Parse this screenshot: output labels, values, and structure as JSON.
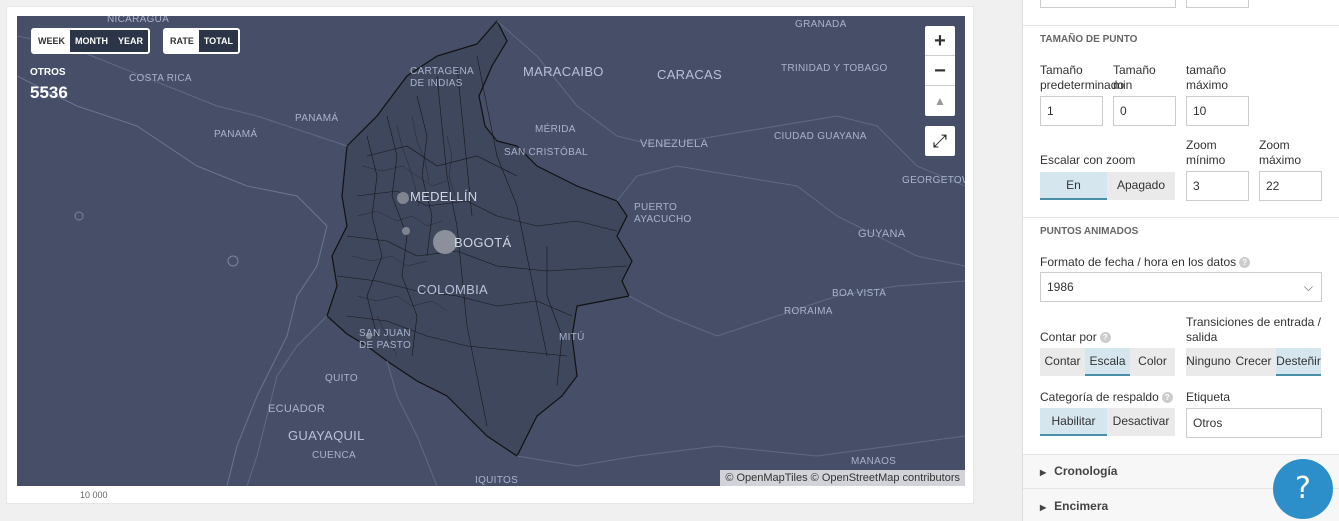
{
  "map": {
    "time_buttons": [
      "WEEK",
      "MONTH",
      "YEAR"
    ],
    "mode_buttons": [
      "RATE",
      "TOTAL"
    ],
    "count_label": "OTROS",
    "count_value": "5536",
    "zoom_in": "+",
    "zoom_out": "−",
    "north": "▲",
    "fullscreen": "⤢",
    "attribution": "© OpenMapTiles © OpenStreetMap contributors",
    "axis_stub": "10 000",
    "places": [
      {
        "id": "nicaragua",
        "text": "NICARAGUA"
      },
      {
        "id": "costa-rica",
        "text": "COSTA RICA"
      },
      {
        "id": "panama",
        "text": "PANAMÁ"
      },
      {
        "id": "panama-city",
        "text": "PANAMÁ"
      },
      {
        "id": "cartagena",
        "text": "CARTAGENA DE INDIAS"
      },
      {
        "id": "maracaibo",
        "text": "MARACAIBO"
      },
      {
        "id": "caracas",
        "text": "CARACAS"
      },
      {
        "id": "granada",
        "text": "GRANADA"
      },
      {
        "id": "trinidad",
        "text": "TRINIDAD Y TOBAGO"
      },
      {
        "id": "merida",
        "text": "MÉRIDA"
      },
      {
        "id": "san-cristobal",
        "text": "SAN CRISTÓBAL"
      },
      {
        "id": "venezuela",
        "text": "VENEZUELA"
      },
      {
        "id": "ciudad-guayana",
        "text": "CIUDAD GUAYANA"
      },
      {
        "id": "georgetown",
        "text": "GEORGETOW"
      },
      {
        "id": "medellin",
        "text": "MEDELLÍN"
      },
      {
        "id": "bogota",
        "text": "BOGOTÁ"
      },
      {
        "id": "colombia",
        "text": "COLOMBIA"
      },
      {
        "id": "puerto-ayacucho",
        "text": "PUERTO AYACUCHO"
      },
      {
        "id": "guyana",
        "text": "GUYANA"
      },
      {
        "id": "boa-vista",
        "text": "BOA VISTA"
      },
      {
        "id": "roraima",
        "text": "RORAIMA"
      },
      {
        "id": "san-juan",
        "text": "SAN JUAN DE PASTO"
      },
      {
        "id": "mitu",
        "text": "MITÚ"
      },
      {
        "id": "quito",
        "text": "QUITO"
      },
      {
        "id": "ecuador",
        "text": "ECUADOR"
      },
      {
        "id": "guayaquil",
        "text": "GUAYAQUIL"
      },
      {
        "id": "cuenca",
        "text": "CUENCA"
      },
      {
        "id": "iquitos",
        "text": "IQUITOS"
      },
      {
        "id": "manaos",
        "text": "MANAOS"
      }
    ]
  },
  "panel": {
    "point_size": {
      "title": "TAMAÑO DE PUNTO",
      "default_label": "Tamaño predeterminado",
      "default_value": "1",
      "min_label": "Tamaño min",
      "min_value": "0",
      "max_label": "tamaño máximo",
      "max_value": "10",
      "scale_label": "Escalar con zoom",
      "scale_options": [
        "En",
        "Apagado"
      ],
      "zoom_min_label": "Zoom mínimo",
      "zoom_min_value": "3",
      "zoom_max_label": "Zoom máximo",
      "zoom_max_value": "22"
    },
    "animated": {
      "title": "PUNTOS ANIMADOS",
      "date_format_label": "Formato de fecha / hora en los datos",
      "date_format_value": "1986",
      "count_by_label": "Contar por",
      "count_by_options": [
        "Contar",
        "Escala",
        "Color"
      ],
      "transitions_label": "Transiciones de entrada / salida",
      "transitions_options": [
        "Ninguno",
        "Crecer",
        "Desteñir"
      ],
      "fallback_label": "Categoría de respaldo",
      "fallback_options": [
        "Habilitar",
        "Desactivar"
      ],
      "tag_label": "Etiqueta",
      "tag_value": "Otros"
    },
    "timeline_label": "Cronología",
    "top_label": "Encimera",
    "help": "?"
  },
  "colors": {
    "map_bg": "#444d66",
    "accent": "#4a8fa8",
    "help": "#2c8fc9"
  }
}
